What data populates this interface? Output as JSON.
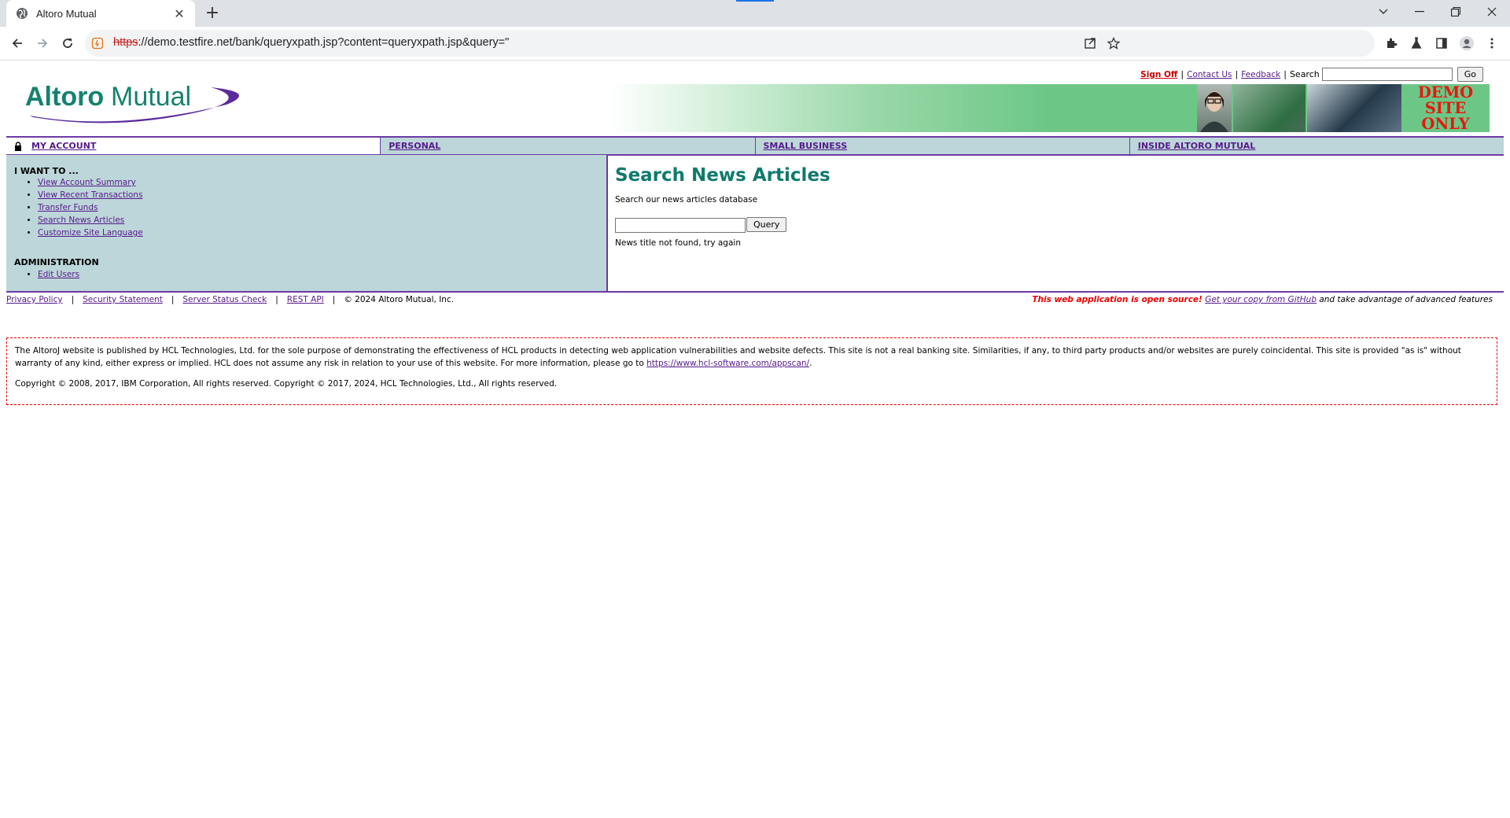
{
  "browser": {
    "tab_title": "Altoro Mutual",
    "url_scheme": "https",
    "url_rest": "://demo.testfire.net/bank/queryxpath.jsp?content=queryxpath.jsp&query=\""
  },
  "header": {
    "logo_text_1": "Altoro",
    "logo_text_2": "Mutual",
    "sign_off": "Sign Off",
    "contact_us": "Contact Us",
    "feedback": "Feedback",
    "search_label": "Search",
    "search_value": "",
    "go_label": "Go",
    "separator": "|",
    "demo_line1": "DEMO",
    "demo_line2": "SITE",
    "demo_line3": "ONLY"
  },
  "nav": {
    "my_account": "MY ACCOUNT",
    "personal": "PERSONAL",
    "small_business": "SMALL BUSINESS",
    "inside": "INSIDE ALTORO MUTUAL"
  },
  "sidebar": {
    "i_want_to": "I WANT TO ...",
    "links": [
      "View Account Summary",
      "View Recent Transactions",
      "Transfer Funds",
      "Search News Articles",
      "Customize Site Language"
    ],
    "administration": "ADMINISTRATION",
    "admin_links": [
      "Edit Users"
    ]
  },
  "content": {
    "title": "Search News Articles",
    "description": "Search our news articles database",
    "query_value": "",
    "query_button": "Query",
    "result": "News title not found, try again"
  },
  "footer": {
    "privacy": "Privacy Policy",
    "security": "Security Statement",
    "server_status": "Server Status Check",
    "rest_api": "REST API",
    "copyright": "© 2024 Altoro Mutual, Inc.",
    "separator": "|",
    "open_source": "This web application is open source!",
    "github_link": "Get your copy from GitHub",
    "advanced": "and take advantage of advanced features"
  },
  "disclaimer": {
    "text1": "The AltoroJ website is published by HCL Technologies, Ltd. for the sole purpose of demonstrating the effectiveness of HCL products in detecting web application vulnerabilities and website defects. This site is not a real banking site. Similarities, if any, to third party products and/or websites are purely coincidental. This site is provided \"as is\" without warranty of any kind, either express or implied. HCL does not assume any risk in relation to your use of this website. For more information, please go to",
    "link": "https://www.hcl-software.com/appscan/",
    "period": ".",
    "copyright": "Copyright © 2008, 2017, IBM Corporation, All rights reserved. Copyright © 2017, 2024, HCL Technologies, Ltd., All rights reserved."
  },
  "colors": {
    "accent_purple": "#6c3ba4",
    "panel": "#bdd6d9",
    "title_teal": "#0f7a6c",
    "alert_red": "#e00000"
  }
}
